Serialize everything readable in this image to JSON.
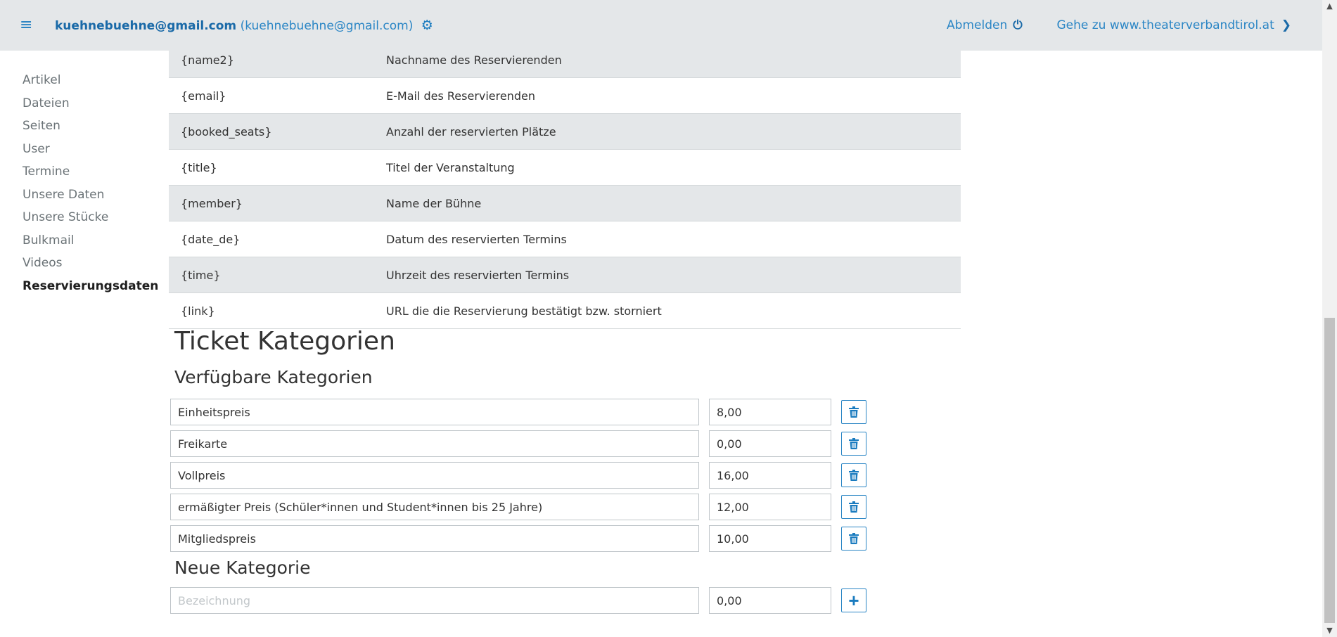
{
  "header": {
    "user_email": "kuehnebuehne@gmail.com",
    "user_email_paren": "(kuehnebuehne@gmail.com)",
    "logout_label": "Abmelden",
    "goto_label": "Gehe zu www.theaterverbandtirol.at",
    "accent_color": "#1a7bbf"
  },
  "sidebar": {
    "items": [
      {
        "label": "Artikel"
      },
      {
        "label": "Dateien"
      },
      {
        "label": "Seiten"
      },
      {
        "label": "User"
      },
      {
        "label": "Termine"
      },
      {
        "label": "Unsere Daten"
      },
      {
        "label": "Unsere Stücke"
      },
      {
        "label": "Bulkmail"
      },
      {
        "label": "Videos"
      },
      {
        "label": "Reservierungsdaten"
      }
    ],
    "active_item": "Reservierungsdaten"
  },
  "placeholders": [
    {
      "key": "{name2}",
      "description": "Nachname des Reservierenden"
    },
    {
      "key": "{email}",
      "description": "E-Mail des Reservierenden"
    },
    {
      "key": "{booked_seats}",
      "description": "Anzahl der reservierten Plätze"
    },
    {
      "key": "{title}",
      "description": "Titel der Veranstaltung"
    },
    {
      "key": "{member}",
      "description": "Name der Bühne"
    },
    {
      "key": "{date_de}",
      "description": "Datum des reservierten Termins"
    },
    {
      "key": "{time}",
      "description": "Uhrzeit des reservierten Termins"
    },
    {
      "key": "{link}",
      "description": "URL die die Reservierung bestätigt bzw. storniert"
    }
  ],
  "tickets": {
    "title": "Ticket Kategorien",
    "available_title": "Verfügbare Kategorien",
    "categories": [
      {
        "name": "Einheitspreis",
        "price": "8,00"
      },
      {
        "name": "Freikarte",
        "price": "0,00"
      },
      {
        "name": "Vollpreis",
        "price": "16,00"
      },
      {
        "name": "ermäßigter Preis (Schüler*innen und Student*innen bis 25 Jahre)",
        "price": "12,00"
      },
      {
        "name": "Mitgliedspreis",
        "price": "10,00"
      }
    ],
    "new_title": "Neue Kategorie",
    "new_name_placeholder": "Bezeichnung",
    "new_price": "0,00"
  }
}
